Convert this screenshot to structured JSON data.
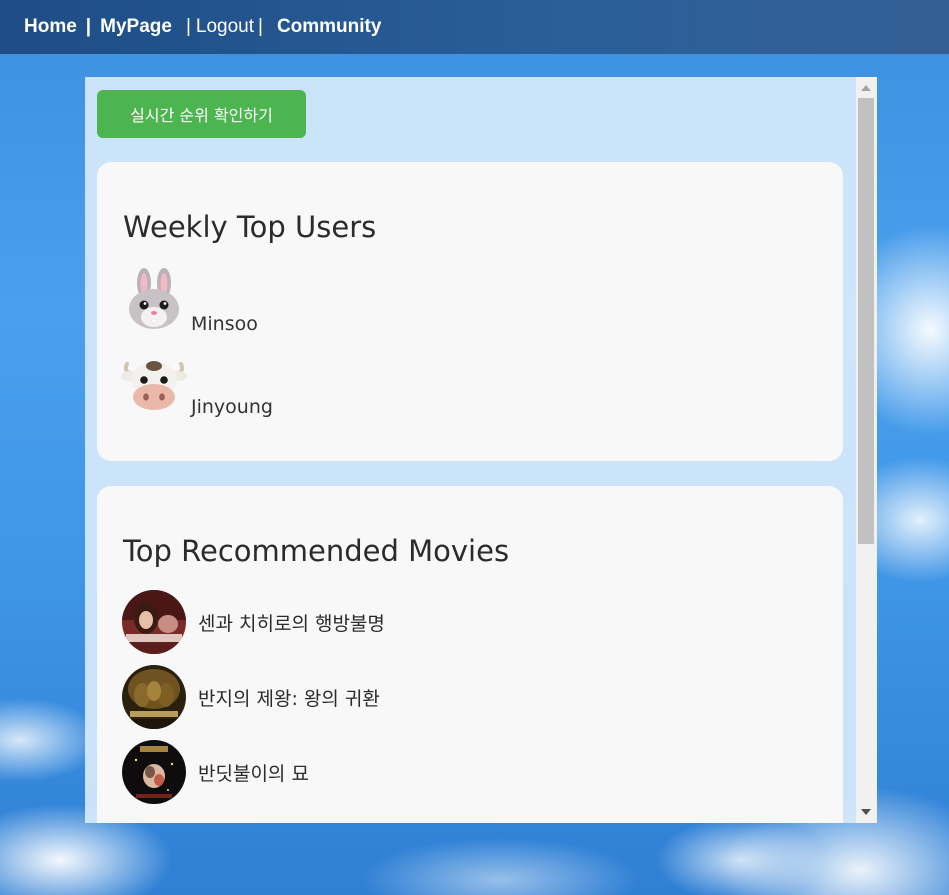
{
  "nav": {
    "home": "Home",
    "sep1": "|",
    "mypage": "MyPage",
    "sep2": "|",
    "logout": "Logout",
    "sep3": "|",
    "community": "Community"
  },
  "rank_button": "실시간 순위 확인하기",
  "weekly_users": {
    "title": "Weekly Top Users",
    "users": [
      {
        "name": "Minsoo",
        "avatar_icon": "rabbit-face-icon"
      },
      {
        "name": "Jinyoung",
        "avatar_icon": "cow-face-icon"
      }
    ]
  },
  "top_movies": {
    "title": "Top Recommended Movies",
    "movies": [
      {
        "title": "센과 치히로의 행방불명",
        "poster_icon": "spirited-away-poster"
      },
      {
        "title": "반지의 제왕: 왕의 귀환",
        "poster_icon": "lotr-return-of-the-king-poster"
      },
      {
        "title": "반딧불이의 묘",
        "poster_icon": "grave-of-the-fireflies-poster"
      }
    ]
  },
  "colors": {
    "nav_bg": "#2a5f99",
    "button_green": "#4cb54f",
    "card_bg": "#f8f8f8",
    "panel_bg": "#d6e9fb"
  }
}
